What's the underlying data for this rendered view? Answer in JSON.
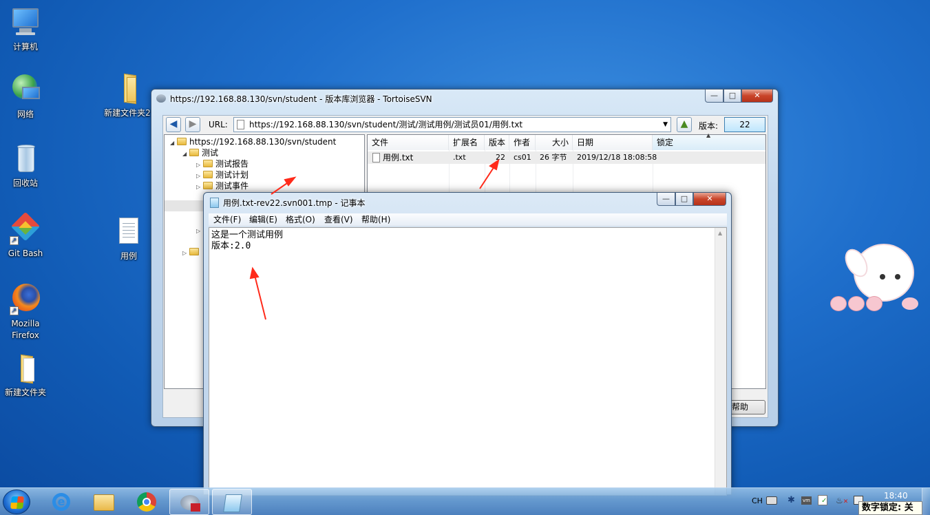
{
  "desktop": {
    "icons": [
      {
        "label": "计算机"
      },
      {
        "label": "网络"
      },
      {
        "label": "回收站"
      },
      {
        "label": "Git Bash"
      },
      {
        "label": "Mozilla Firefox"
      },
      {
        "label": "新建文件夹"
      },
      {
        "label": "新建文件夹2"
      },
      {
        "label": "用例"
      }
    ]
  },
  "svn_browser": {
    "title": "https://192.168.88.130/svn/student - 版本库浏览器 - TortoiseSVN",
    "url_label": "URL:",
    "url_value": "https://192.168.88.130/svn/student/测试/测试用例/测试员01/用例.txt",
    "revision_label": "版本:",
    "revision_value": "22",
    "help_button": "帮助",
    "tree": {
      "root": "https://192.168.88.130/svn/student",
      "child": "测试",
      "items": [
        "测试报告",
        "测试计划",
        "测试事件"
      ]
    },
    "columns": [
      "文件",
      "扩展名",
      "版本",
      "作者",
      "大小",
      "日期",
      "锁定"
    ],
    "rows": [
      {
        "file": "用例.txt",
        "ext": ".txt",
        "revision": "22",
        "author": "cs01",
        "size": "26 字节",
        "date": "2019/12/18 18:08:58",
        "lock": ""
      }
    ]
  },
  "notepad": {
    "title": "用例.txt-rev22.svn001.tmp - 记事本",
    "menu": [
      "文件(F)",
      "编辑(E)",
      "格式(O)",
      "查看(V)",
      "帮助(H)"
    ],
    "lines": [
      "这是一个测试用例",
      "版本:2.0"
    ]
  },
  "taskbar": {
    "input_method": "CH",
    "time": "18:40",
    "numlock_status": "数字锁定: 关"
  },
  "colors": {
    "accent": "#1f6fcc",
    "arrow": "#ff2a1a"
  }
}
